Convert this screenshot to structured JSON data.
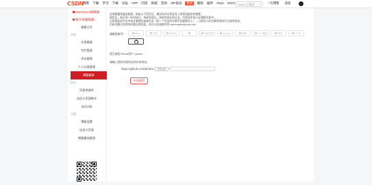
{
  "topbar": {
    "logo": "CSDN",
    "nav": [
      "博客",
      "下载",
      "学习",
      "下载",
      "论坛",
      "APP",
      "问答",
      "商城",
      "活动",
      "VIP会员",
      "专栏",
      "版权",
      "插件",
      "iTeye",
      "GitChat",
      "图文课"
    ],
    "nav_badge": "专栏",
    "search_placeholder": "Python工程师",
    "write_label": "写博客",
    "message_label": "消息"
  },
  "sidebar": {
    "links": [
      "Markdown编辑器",
      "富文本编辑器"
    ],
    "items": [
      {
        "label": "查看主页",
        "group": null
      },
      {
        "label": "文章管理",
        "group": "内容"
      },
      {
        "label": "专栏管理",
        "group": null
      },
      {
        "label": "评论管理",
        "group": null
      },
      {
        "label": "个人分类管理",
        "group": null
      },
      {
        "label": "博客搬家",
        "group": null,
        "active": true
      },
      {
        "label": "页面关键字",
        "group": "统计"
      },
      {
        "label": "自定义页面统计",
        "group": null
      },
      {
        "label": "访问分析",
        "group": null
      },
      {
        "label": "博客设置",
        "group": "设置"
      },
      {
        "label": "自定义页面",
        "group": null
      },
      {
        "label": "博客模块管理",
        "group": null
      }
    ],
    "groups": [
      "内容",
      "统计",
      "设置"
    ]
  },
  "content": {
    "notice_lines": [
      "此博客搬家服务都是，绑定以下项目后，博文和评论将会导入到您所绑定的博客。",
      "绑定后，每天同一时间执行，系统完成后，系统完成后的日志，内容同步显示在博客列表中。",
      "当您绑定的平台中有文章提交或者任务（同一个任务的文章不会重复导入），已经导入的文章将保持为之前的状态。",
      "仍有问题可反馈到问题反馈页面，也可以发送邮件到 webmaster@csdn.net。"
    ],
    "bind_label": "请绑定账号：",
    "platforms": [
      {
        "name": "Blog",
        "on": false
      },
      {
        "name": "简书",
        "on": false
      },
      {
        "name": "WeBlog",
        "on": false
      },
      {
        "name": "",
        "on": false
      },
      {
        "name": "开源中国",
        "on": false
      },
      {
        "name": "cnblogs",
        "on": false
      },
      {
        "name": "微博",
        "on": false
      },
      {
        "name": "个人博客",
        "on": false
      },
      {
        "name": "新浪",
        "on": false
      },
      {
        "name": "公众号",
        "on": false
      },
      {
        "name": "",
        "on": true
      }
    ],
    "bound_user": "您已绑定Github用户: ykrdev",
    "url_label": "请输入您的代码所在的仓库地址：",
    "url_prefix": "https://github.com/ykrdev/",
    "repo_placeholder": "仓库名称",
    "url_slash": "/",
    "apply_label": "申请搬家"
  }
}
